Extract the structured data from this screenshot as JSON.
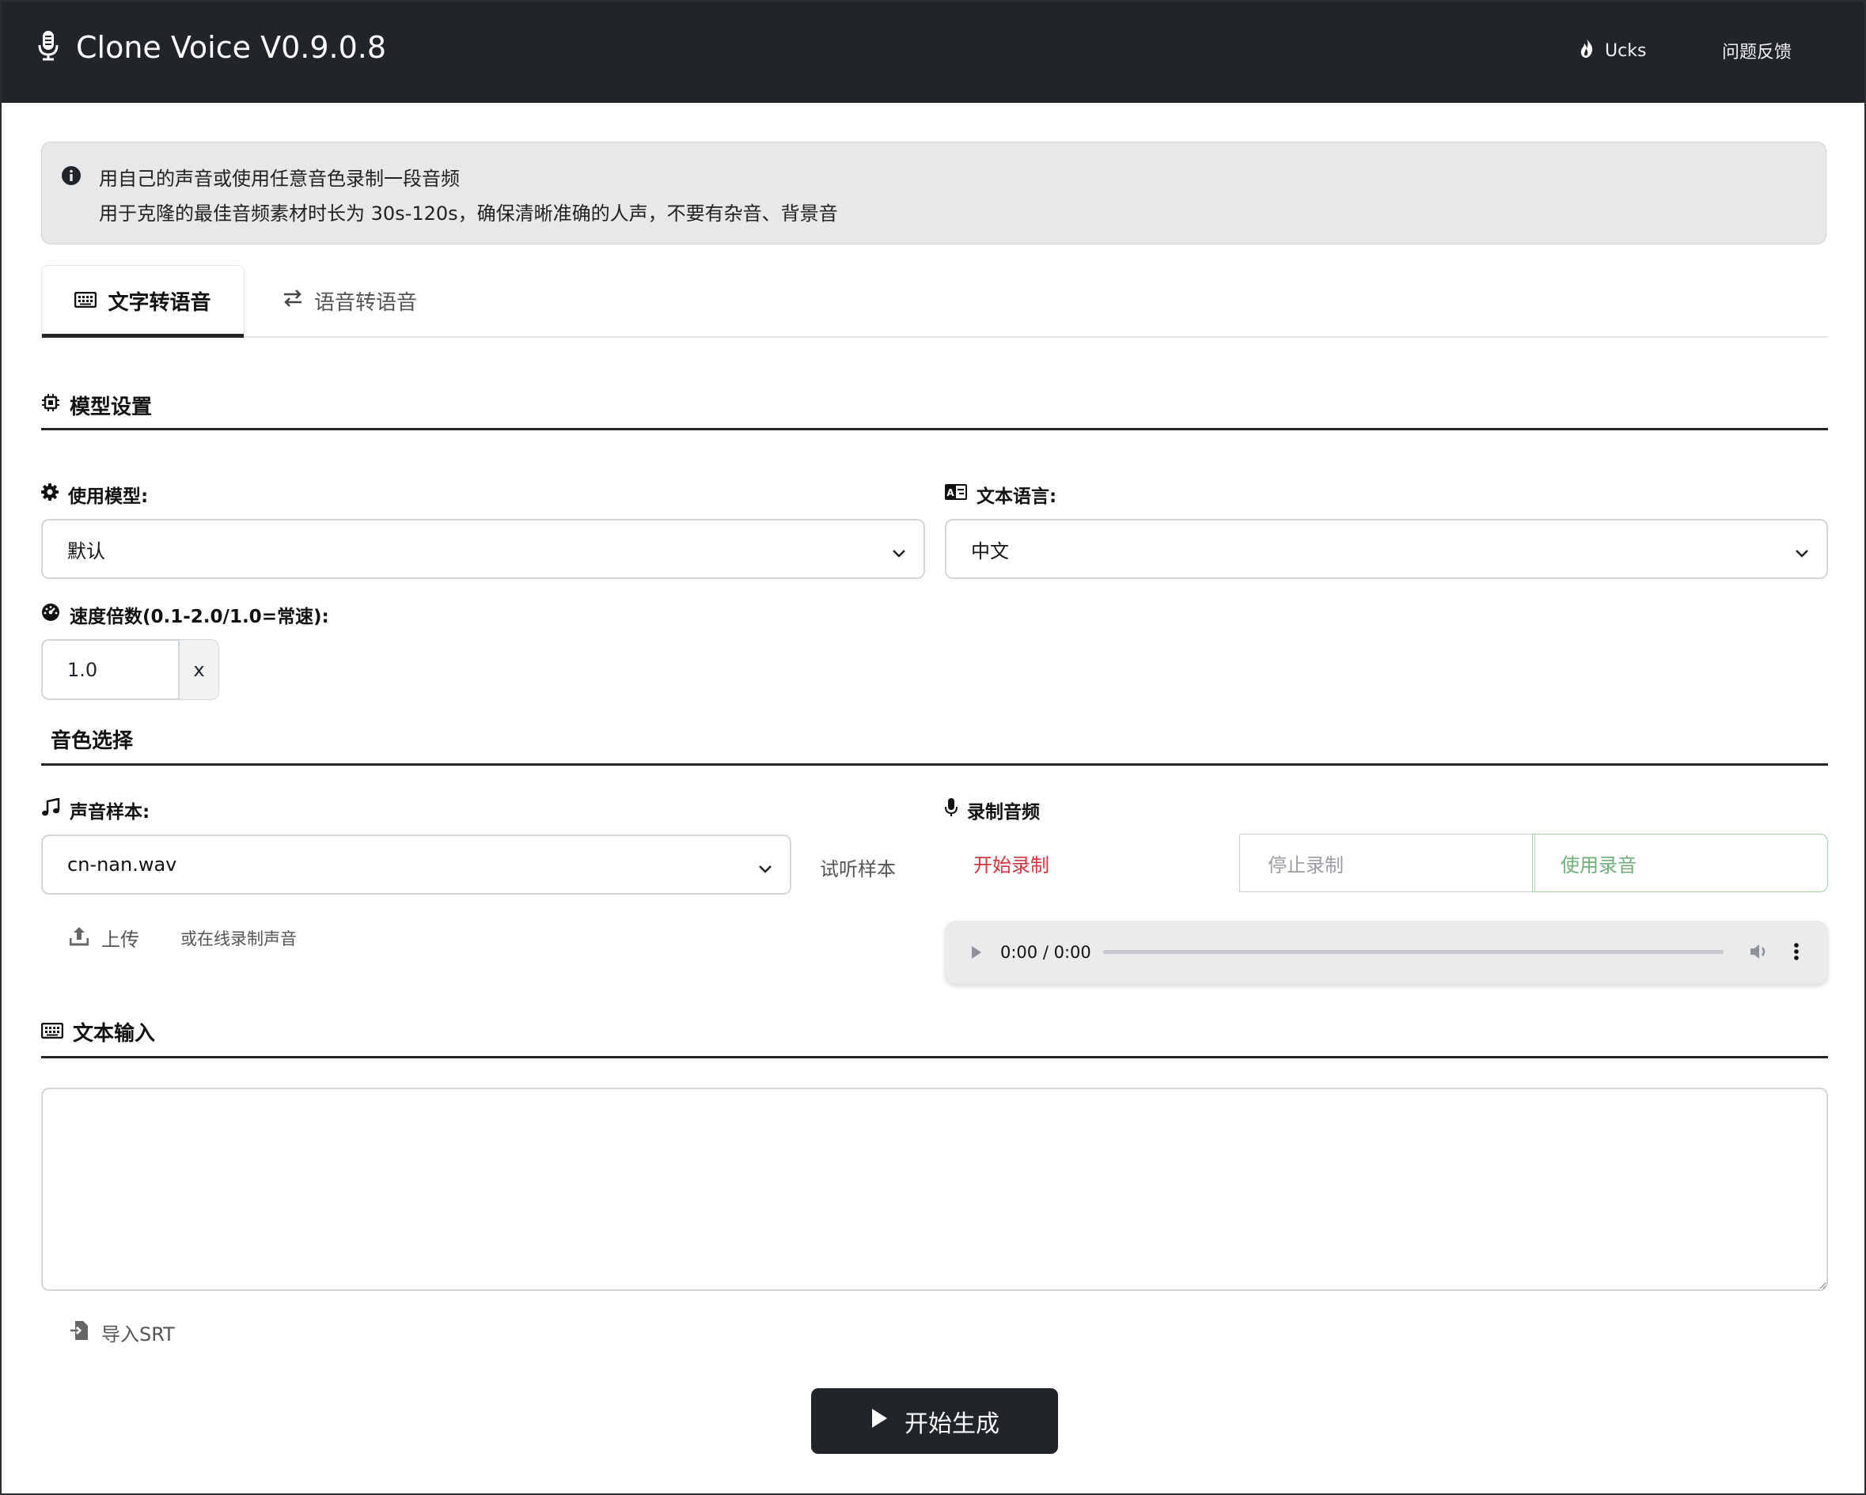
{
  "navbar": {
    "title": "Clone Voice V0.9.0.8",
    "links": [
      {
        "label": "Ucks",
        "icon": "flame-icon"
      },
      {
        "label": "问题反馈"
      }
    ]
  },
  "alert": {
    "icon": "info-circle-icon",
    "lines": [
      "用自己的声音或使用任意音色录制一段音频",
      "用于克隆的最佳音频素材时长为 30s-120s，确保清晰准确的人声，不要有杂音、背景音"
    ]
  },
  "tabs": [
    {
      "label": "文字转语音",
      "icon": "keyboard-icon",
      "active": true
    },
    {
      "label": "语音转语音",
      "icon": "swap-arrows-icon",
      "active": false
    }
  ],
  "model_settings": {
    "title": "模型设置",
    "model_label": "使用模型:",
    "model_value": "默认",
    "language_label": "文本语言:",
    "language_value": "中文",
    "speed_label": "速度倍数(0.1-2.0/1.0=常速):",
    "speed_value": "1.0",
    "speed_suffix": "x"
  },
  "voice": {
    "title": "音色选择",
    "sample_label": "声音样本:",
    "sample_value": "cn-nan.wav",
    "preview_label": "试听样本",
    "upload_label": "上传",
    "record_online_label": "或在线录制声音",
    "record_title": "录制音频",
    "start_record": "开始录制",
    "stop_record": "停止录制",
    "use_record": "使用录音",
    "audio_time": "0:00 / 0:00"
  },
  "text_input": {
    "title": "文本输入",
    "value": "",
    "import_label": "导入SRT"
  },
  "generate_label": "开始生成",
  "colors": {
    "navbar": "#212529",
    "danger": "#d0353f",
    "success_text": "#6fae7a",
    "success_border": "#9fd0a8"
  }
}
